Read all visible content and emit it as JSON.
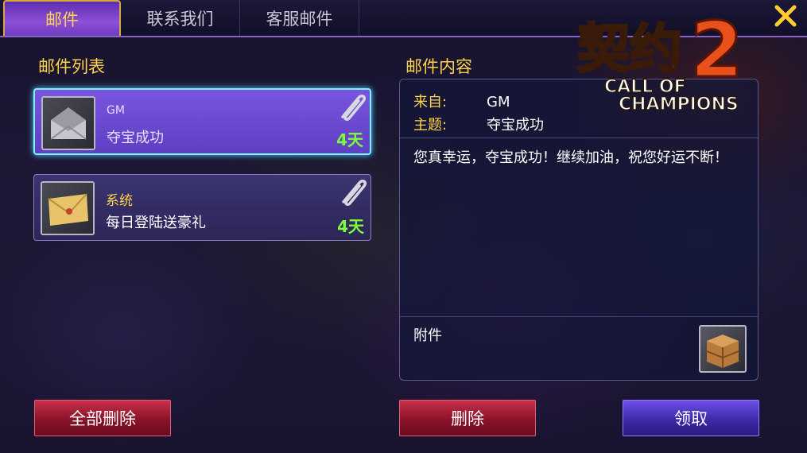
{
  "tabs": [
    {
      "label": "邮件",
      "active": true
    },
    {
      "label": "联系我们",
      "active": false
    },
    {
      "label": "客服邮件",
      "active": false
    }
  ],
  "close_icon": "close-icon",
  "list_section": {
    "title": "邮件列表"
  },
  "mails": [
    {
      "sender": "GM",
      "subject": "夺宝成功",
      "days_left": "4天",
      "icon": "mail-open-icon",
      "has_attachment": true,
      "selected": true
    },
    {
      "sender": "系统",
      "subject": "每日登陆送豪礼",
      "days_left": "4天",
      "icon": "mail-closed-icon",
      "has_attachment": true,
      "selected": false
    }
  ],
  "content_section": {
    "title": "邮件内容",
    "from_label": "来自:",
    "from_value": "GM",
    "subject_label": "主题:",
    "subject_value": "夺宝成功",
    "body": "您真幸运，夺宝成功！继续加油，祝您好运不断！",
    "attachment_label": "附件",
    "attachment_icon": "wooden-crate-icon"
  },
  "logo": {
    "title_cn": "契约",
    "number": "2",
    "subtitle_line1": "CALL OF",
    "subtitle_line2": "CHAMPIONS"
  },
  "buttons": {
    "delete_all": "全部删除",
    "delete": "删除",
    "claim": "领取"
  },
  "colors": {
    "accent_gold": "#ffd34a",
    "days_green": "#7cff3a",
    "selected_border": "#7ff0ff",
    "button_red": "#8a1228",
    "button_blue": "#3c2aa8"
  }
}
